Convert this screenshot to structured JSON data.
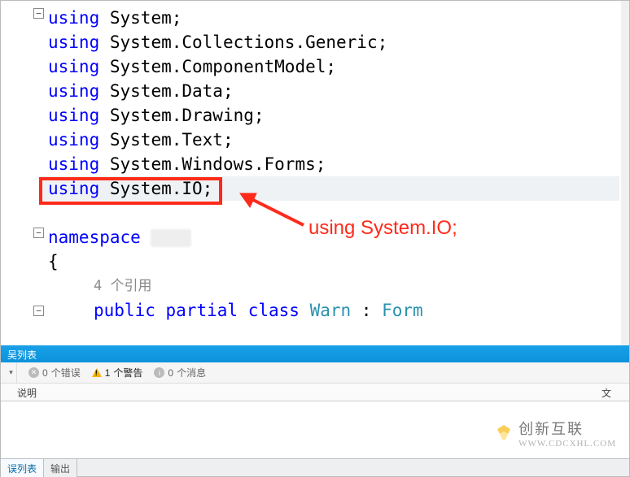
{
  "code": {
    "lines": [
      {
        "kind": "using",
        "ns": "System"
      },
      {
        "kind": "using",
        "ns": "System.Collections.Generic"
      },
      {
        "kind": "using",
        "ns": "System.ComponentModel"
      },
      {
        "kind": "using",
        "ns": "System.Data"
      },
      {
        "kind": "using",
        "ns": "System.Drawing"
      },
      {
        "kind": "using",
        "ns": "System.Text"
      },
      {
        "kind": "using",
        "ns": "System.Windows.Forms"
      },
      {
        "kind": "using",
        "ns": "System.IO",
        "highlight": true
      }
    ],
    "namespace_kw": "namespace",
    "references_text": "4 个引用",
    "class_decl": {
      "pub": "public",
      "part": "partial",
      "cls": "class",
      "name": "Warn",
      "base": "Form"
    }
  },
  "annotation": {
    "callout": "using System.IO;"
  },
  "error_panel": {
    "title": "吴列表",
    "errors": {
      "count": "0",
      "label": "个错误"
    },
    "warnings": {
      "count": "1",
      "label": "个警告"
    },
    "messages": {
      "count": "0",
      "label": "个消息"
    },
    "columns": {
      "desc": "说明",
      "file": "文件"
    }
  },
  "bottom_tabs": {
    "a": "误列表",
    "b": "输出"
  },
  "watermark": {
    "brand": "创新互联",
    "url": "WWW.CDCXHL.COM"
  }
}
